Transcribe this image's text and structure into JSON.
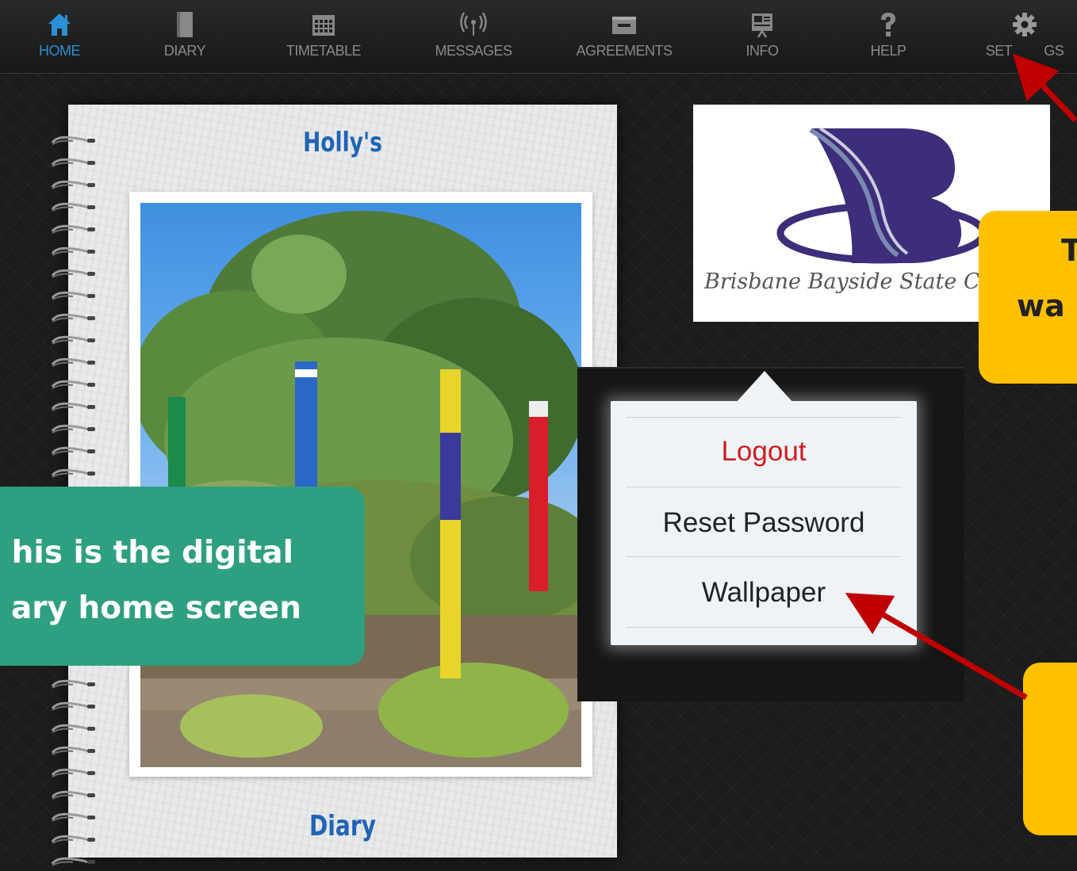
{
  "nav": {
    "items": [
      {
        "label": "HOME",
        "icon": "home-icon",
        "active": true
      },
      {
        "label": "DIARY",
        "icon": "book-icon"
      },
      {
        "label": "TIMETABLE",
        "icon": "calendar-icon"
      },
      {
        "label": "MESSAGES",
        "icon": "broadcast-icon"
      },
      {
        "label": "AGREEMENTS",
        "icon": "agreement-icon"
      },
      {
        "label": "INFO",
        "icon": "presentation-icon"
      },
      {
        "label": "HELP",
        "icon": "question-icon"
      },
      {
        "label": "SET",
        "icon": "gear-icon"
      }
    ],
    "settings_label_right": "GS"
  },
  "diary": {
    "title": "Holly's",
    "footer": "Diary"
  },
  "school": {
    "name": "Brisbane Bayside State C"
  },
  "menu": {
    "logout": "Logout",
    "reset_password": "Reset Password",
    "wallpaper": "Wallpaper"
  },
  "callouts": {
    "home_line1": "his is the digital",
    "home_line2": "ary home screen",
    "settings_line1": "T",
    "settings_line2": "wa"
  },
  "colors": {
    "accent_blue": "#2a8fd6",
    "logout_red": "#d01c1c",
    "callout_green": "#2e9f80",
    "callout_yellow": "#ffc000",
    "arrow_red": "#c00000"
  }
}
